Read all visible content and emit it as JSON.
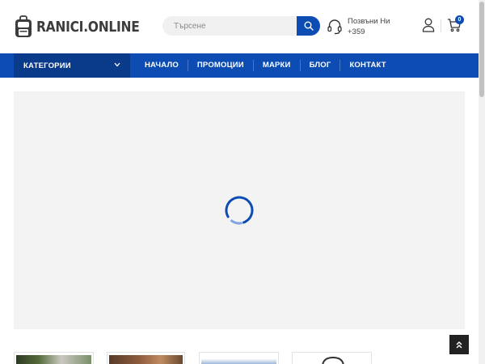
{
  "header": {
    "logo_text": "RANICI.ONLINE",
    "logo_icon": "backpack-icon",
    "search_placeholder": "Търсене",
    "search_icon": "search-icon",
    "call_label": "Позвъни Ни",
    "call_number": "+359",
    "call_icon": "headset-icon",
    "account_icon": "user-icon",
    "cart_icon": "cart-icon",
    "cart_count": "0"
  },
  "nav": {
    "categories_label": "КАТЕГОРИИ",
    "items": [
      {
        "label": "НАЧАЛО"
      },
      {
        "label": "ПРОМОЦИИ"
      },
      {
        "label": "МАРКИ"
      },
      {
        "label": "БЛОГ"
      },
      {
        "label": "КОНТАКТ"
      }
    ]
  },
  "slider": {
    "state": "loading",
    "loader_icon": "spinner-icon"
  },
  "colors": {
    "brand": "#0d4db3",
    "brand_dark": "#0a3a8a",
    "slider_bg": "#f3f3f3",
    "logo_text": "#3c3c3c"
  },
  "scroll_top_icon": "chevron-double-up-icon"
}
